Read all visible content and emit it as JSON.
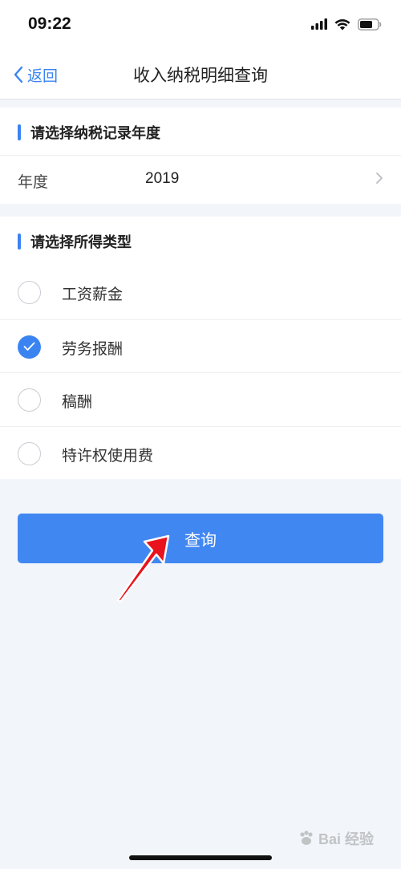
{
  "status_bar": {
    "time": "09:22"
  },
  "nav": {
    "back_label": "返回",
    "title": "收入纳税明细查询"
  },
  "year_section": {
    "title": "请选择纳税记录年度",
    "row_label": "年度",
    "row_value": "2019"
  },
  "income_section": {
    "title": "请选择所得类型",
    "options": [
      {
        "label": "工资薪金",
        "checked": false
      },
      {
        "label": "劳务报酬",
        "checked": true
      },
      {
        "label": "稿酬",
        "checked": false
      },
      {
        "label": "特许权使用费",
        "checked": false
      }
    ]
  },
  "query_button": {
    "label": "查询"
  },
  "watermark": {
    "text": "Bai 经验"
  },
  "colors": {
    "accent": "#3a84f2",
    "button": "#4187f2",
    "background": "#f2f5f9",
    "arrow": "#e8131d"
  }
}
